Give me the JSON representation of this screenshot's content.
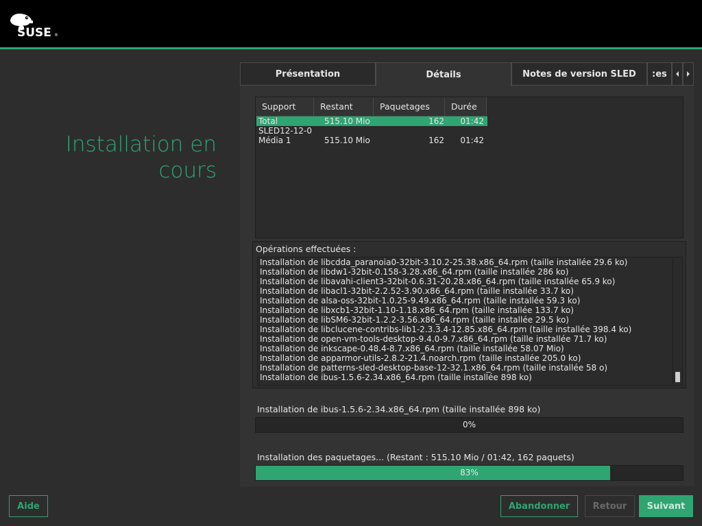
{
  "header": {
    "logo_text": "SUSE"
  },
  "page": {
    "title_line1": "Installation en",
    "title_line2": "cours"
  },
  "tabs": {
    "presentation": "Présentation",
    "details": "Détails",
    "notes": "Notes de version SLED",
    "more": ":es",
    "left_arrow_icon": "chevron-left-icon",
    "right_arrow_icon": "chevron-right-icon",
    "active": "Détails"
  },
  "media": {
    "columns": [
      "Support",
      "Restant",
      "Paquetages",
      "Durée"
    ],
    "rows": [
      {
        "support": "Total",
        "remaining": "515.10 Mio",
        "packages": "162",
        "duration": "01:42",
        "selected": true
      },
      {
        "support": "SLED12-12-0",
        "remaining": "",
        "packages": "",
        "duration": "",
        "selected": false
      },
      {
        "support": "Média 1",
        "remaining": "515.10 Mio",
        "packages": "162",
        "duration": "01:42",
        "selected": false
      }
    ]
  },
  "operations": {
    "label": "Opérations effectuées :",
    "items": [
      "Installation de libcdda_paranoia0-32bit-3.10.2-25.38.x86_64.rpm (taille installée 29.6 ko)",
      "Installation de libdw1-32bit-0.158-3.28.x86_64.rpm (taille installée 286 ko)",
      "Installation de libavahi-client3-32bit-0.6.31-20.28.x86_64.rpm (taille installée 65.9 ko)",
      "Installation de libacl1-32bit-2.2.52-3.90.x86_64.rpm (taille installée 33.7 ko)",
      "Installation de alsa-oss-32bit-1.0.25-9.49.x86_64.rpm (taille installée 59.3 ko)",
      "Installation de libxcb1-32bit-1.10-1.18.x86_64.rpm (taille installée 133.7 ko)",
      "Installation de libSM6-32bit-1.2.2-3.56.x86_64.rpm (taille installée 29.5 ko)",
      "Installation de libclucene-contribs-lib1-2.3.3.4-12.85.x86_64.rpm (taille installée 398.4 ko)",
      "Installation de open-vm-tools-desktop-9.4.0-9.7.x86_64.rpm (taille installée 71.7 ko)",
      "Installation de inkscape-0.48.4-8.7.x86_64.rpm (taille installée 58.07 Mio)",
      "Installation de apparmor-utils-2.8.2-21.4.noarch.rpm (taille installée 205.0 ko)",
      "Installation de patterns-sled-desktop-base-12-32.1.x86_64.rpm (taille installée 58 o)",
      "Installation de ibus-1.5.6-2.34.x86_64.rpm (taille installée 898 ko)"
    ]
  },
  "package_progress": {
    "label": "Installation de ibus-1.5.6-2.34.x86_64.rpm (taille installée 898 ko)",
    "percent": 0,
    "text": "0%"
  },
  "total_progress": {
    "label": "Installation des paquetages... (Restant : 515.10 Mio / 01:42, 162 paquets)",
    "percent": 83,
    "text": "83%"
  },
  "buttons": {
    "help": "Aide",
    "abort": "Abandonner",
    "back": "Retour",
    "next": "Suivant"
  },
  "colors": {
    "accent": "#2fa572",
    "background": "#2d2d2d",
    "header": "#000000"
  }
}
